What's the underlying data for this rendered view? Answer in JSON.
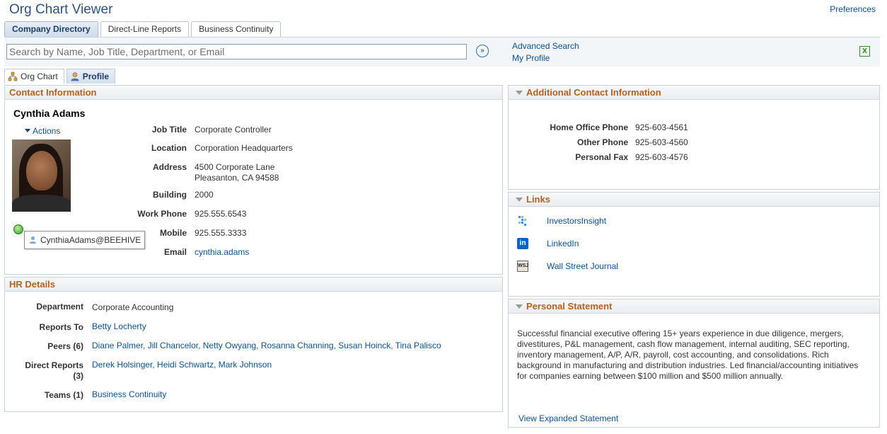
{
  "app": {
    "title": "Org Chart Viewer",
    "preferences": "Preferences"
  },
  "top_tabs": [
    {
      "label": "Company Directory"
    },
    {
      "label": "Direct-Line Reports"
    },
    {
      "label": "Business Continuity"
    }
  ],
  "search": {
    "placeholder": "Search by Name, Job Title, Department, or Email",
    "advanced": "Advanced Search",
    "my_profile": "My Profile"
  },
  "sub_tabs": [
    {
      "label": "Org Chart"
    },
    {
      "label": "Profile"
    }
  ],
  "contact": {
    "header": "Contact Information",
    "name": "Cynthia Adams",
    "actions": "Actions",
    "tooltip": "CynthiaAdams@BEEHIVE",
    "fields": [
      {
        "label": "Job Title",
        "value": "Corporate Controller"
      },
      {
        "label": "Location",
        "value": "Corporation Headquarters"
      },
      {
        "label": "Address",
        "value": "4500 Corporate Lane",
        "value2": "Pleasanton, CA 94588"
      },
      {
        "label": "Building",
        "value": "2000"
      },
      {
        "label": "Work Phone",
        "value": "925.555.6543"
      },
      {
        "label": "Mobile",
        "value": "925.555.3333"
      },
      {
        "label": "Email",
        "value": "cynthia.adams"
      }
    ]
  },
  "hr": {
    "header": "HR Details",
    "department_label": "Department",
    "department": "Corporate Accounting",
    "reports_to_label": "Reports To",
    "reports_to": "Betty Locherty",
    "peers_label": "Peers (6)",
    "peers": [
      "Diane Palmer",
      "Jill Chancelor",
      "Netty Owyang",
      "Rosanna Channing",
      "Susan Hoinck",
      "Tina Palisco"
    ],
    "direct_label": "Direct Reports",
    "direct_count": "(3)",
    "direct": [
      "Derek Holsinger",
      "Heidi Schwartz",
      "Mark Johnson"
    ],
    "teams_label": "Teams (1)",
    "teams": "Business Continuity"
  },
  "additional": {
    "header": "Additional Contact Information",
    "rows": [
      {
        "label": "Home Office Phone",
        "value": "925-603-4561"
      },
      {
        "label": "Other Phone",
        "value": "925-603-4560"
      },
      {
        "label": "Personal Fax",
        "value": "925-603-4576"
      }
    ]
  },
  "links": {
    "header": "Links",
    "items": [
      {
        "label": "InvestorsInsight",
        "icon": "investors-insight-icon"
      },
      {
        "label": "LinkedIn",
        "icon": "linkedin-icon",
        "glyph": "in"
      },
      {
        "label": "Wall Street Journal",
        "icon": "wsj-icon",
        "glyph": "WSJ"
      }
    ]
  },
  "statement": {
    "header": "Personal Statement",
    "text": "Successful financial executive offering 15+ years experience in due diligence, mergers, divestitures, P&L management, cash flow management, internal auditing, SEC reporting, inventory management, A/P, A/R, payroll, cost accounting, and consolidations.  Rich background in manufacturing and distribution industries.  Led financial/accounting initiatives for companies earning between $100 million and $500 million annually.",
    "view_expanded": "View Expanded Statement"
  },
  "colors": {
    "accent": "#b3611f",
    "link": "#0b4f8f",
    "title": "#2d5384"
  }
}
